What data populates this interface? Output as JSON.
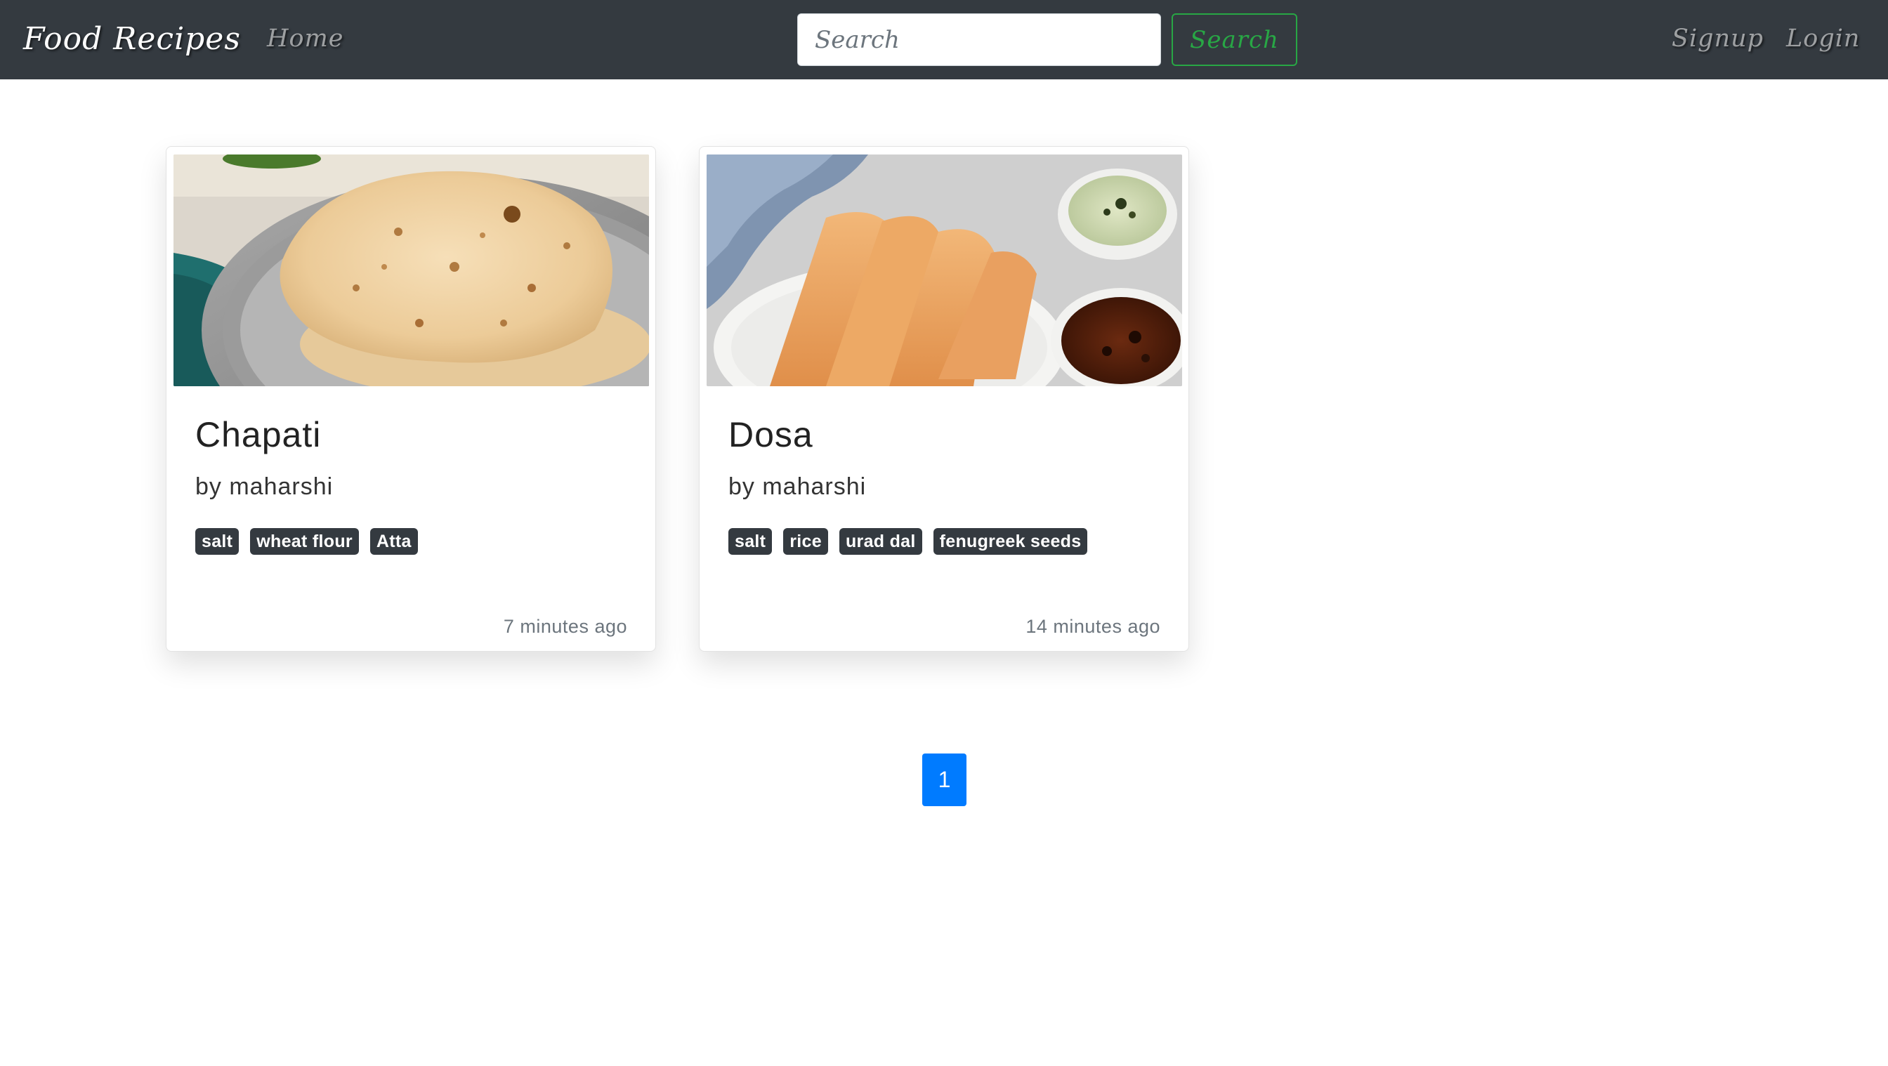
{
  "navbar": {
    "brand": "Food Recipes",
    "home_label": "Home",
    "search_placeholder": "Search",
    "search_button_label": "Search",
    "signup_label": "Signup",
    "login_label": "Login",
    "background_color": "#343a40",
    "search_button_color": "#28a745"
  },
  "recipes": [
    {
      "title": "Chapati",
      "author": "by maharshi",
      "tags": [
        "salt",
        "wheat flour",
        "Atta"
      ],
      "time": "7 minutes ago"
    },
    {
      "title": "Dosa",
      "author": "by maharshi",
      "tags": [
        "salt",
        "rice",
        "urad dal",
        "fenugreek seeds"
      ],
      "time": "14 minutes ago"
    }
  ],
  "pagination": {
    "current_page": "1",
    "active_color": "#007bff"
  }
}
